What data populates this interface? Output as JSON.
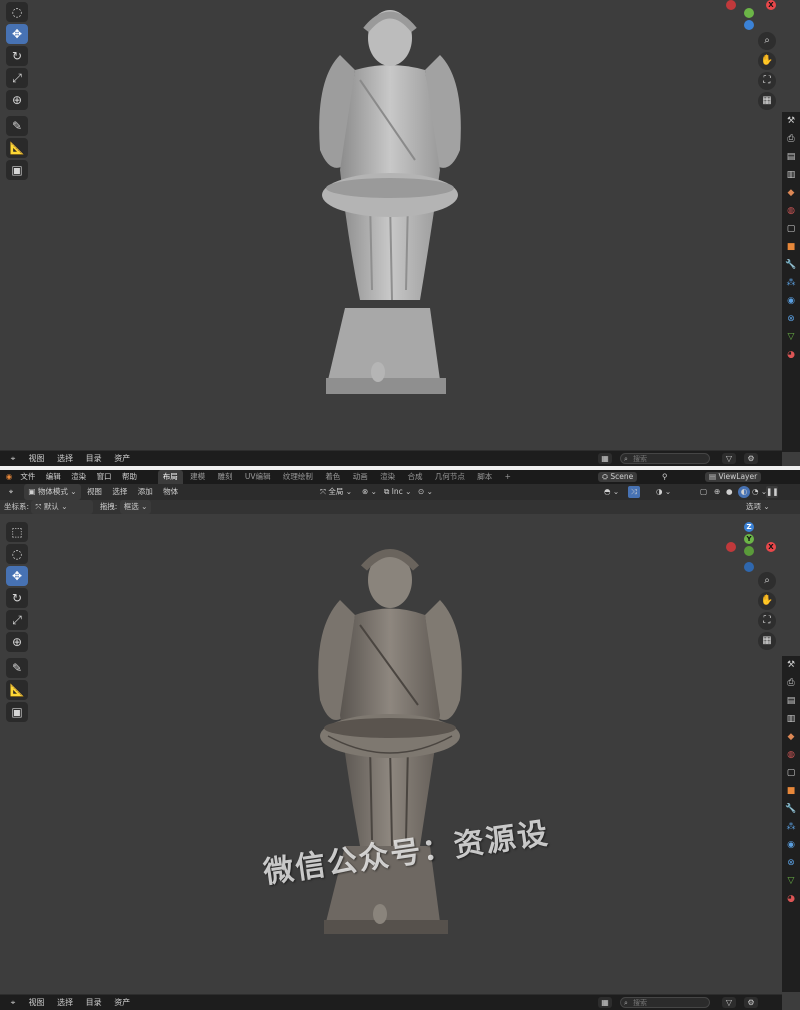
{
  "colors": {
    "accent": "#4772b3",
    "axis_x": "#e8474a",
    "axis_y": "#6cb547",
    "axis_z": "#3b82d6",
    "viewport": "#3d3d3d"
  },
  "top_viewport": {
    "footer": {
      "menu": [
        "视图",
        "选择",
        "目录",
        "资产"
      ],
      "search_placeholder": "搜索"
    }
  },
  "topbar": {
    "menus": [
      "文件",
      "编辑",
      "渲染",
      "窗口",
      "帮助"
    ],
    "workspaces": [
      "布局",
      "建模",
      "雕刻",
      "UV编辑",
      "纹理绘制",
      "着色",
      "动画",
      "渲染",
      "合成",
      "几何节点",
      "脚本"
    ],
    "active_workspace": "布局",
    "add_tab": "+",
    "scene": "Scene",
    "view_layer": "ViewLayer"
  },
  "viewport_header": {
    "mode": "物体模式",
    "menus": [
      "视图",
      "选择",
      "添加",
      "物体"
    ],
    "orientation": "全局",
    "snap": "lnc"
  },
  "viewport_options": {
    "coord_label": "坐标系:",
    "coord_value": "默认",
    "drag_label": "拖拽:",
    "drag_value": "框选",
    "overlay_button": "选项"
  },
  "gizmo": {
    "x": "X",
    "y": "Y",
    "z": "Z"
  },
  "tools": [
    "select-box",
    "cursor",
    "move",
    "rotate",
    "scale",
    "transform",
    "annotate",
    "measure",
    "add-cube"
  ],
  "bottom_viewport": {
    "footer": {
      "menu": [
        "视图",
        "选择",
        "目录",
        "资产"
      ],
      "search_placeholder": "搜索"
    }
  },
  "watermark": "微信公众号：资源设"
}
